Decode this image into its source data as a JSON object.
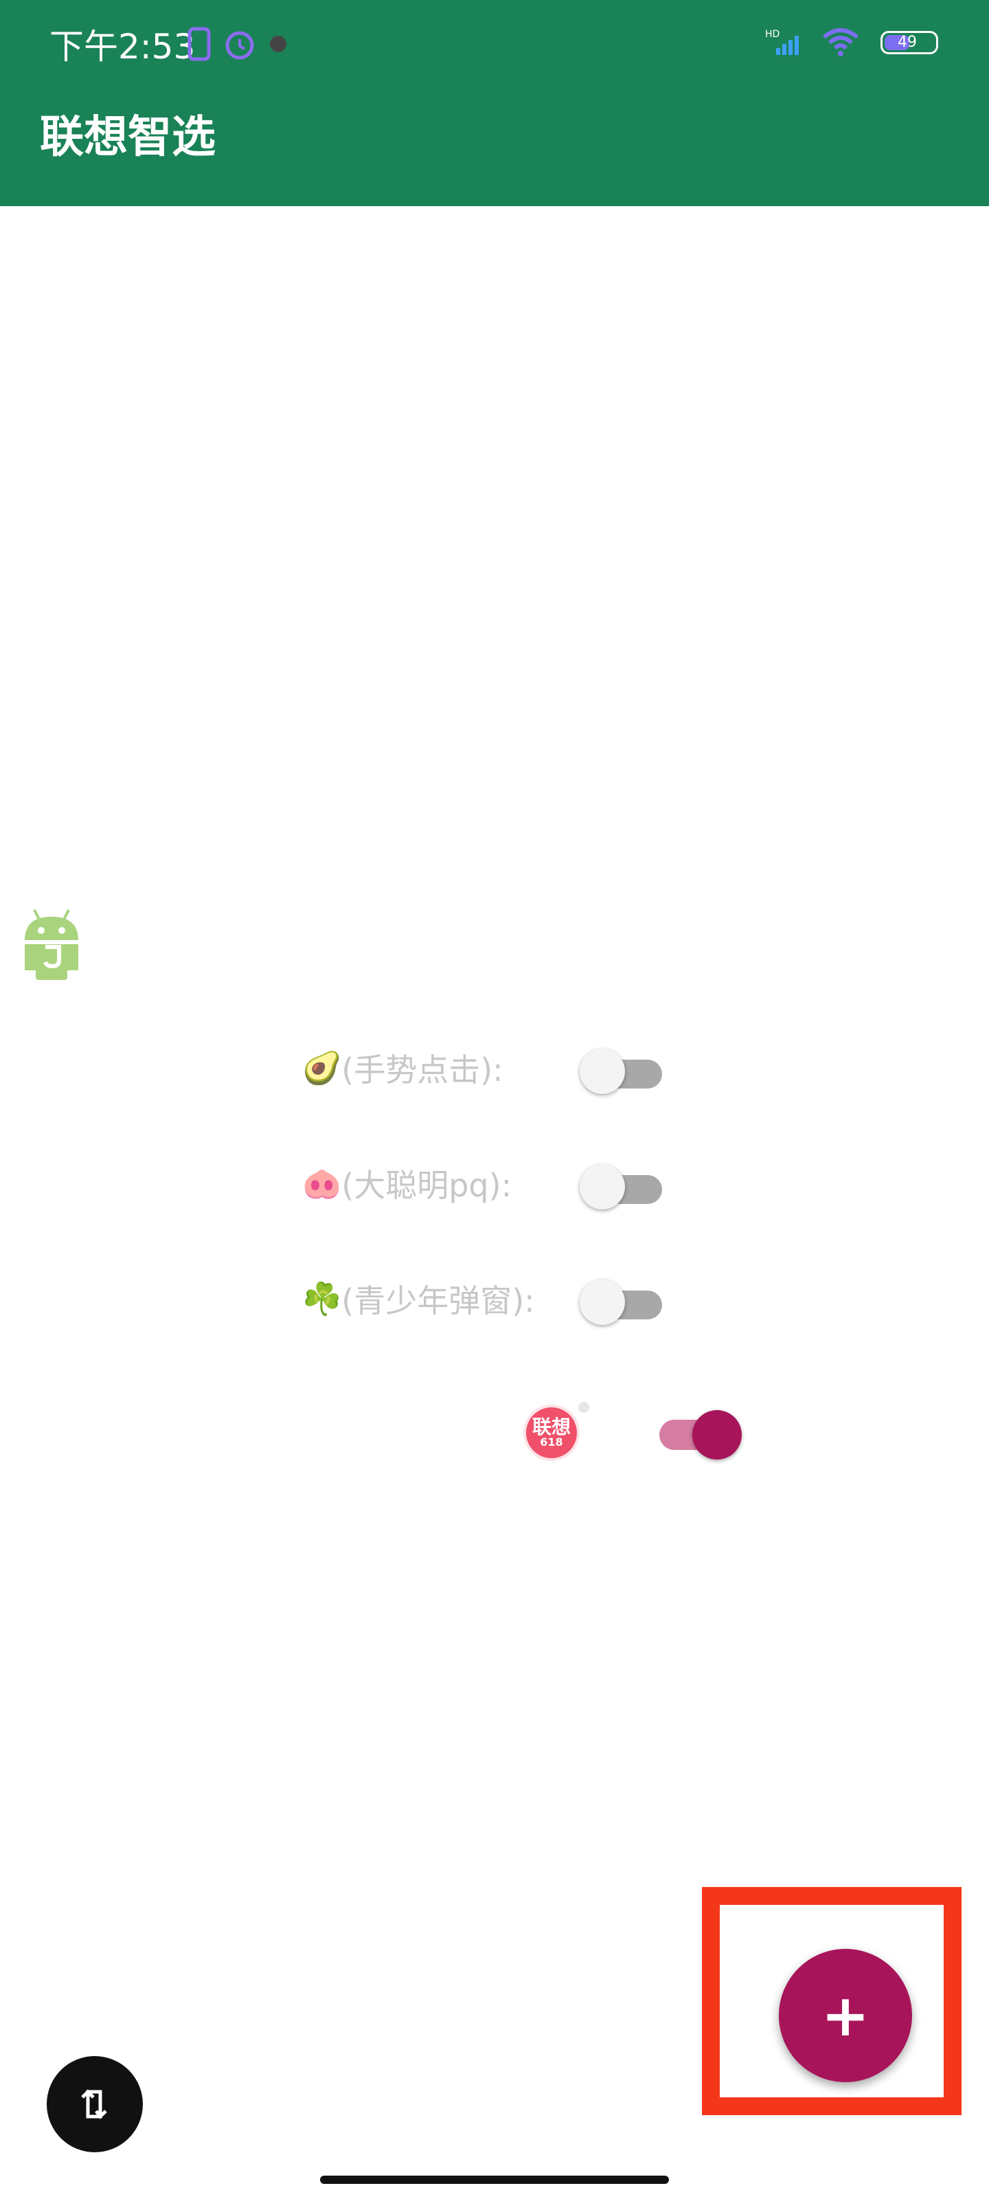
{
  "status_bar": {
    "time": "下午2:53",
    "battery": "49",
    "network": "HD"
  },
  "app_bar": {
    "title": "联想智选"
  },
  "options": [
    {
      "emoji": "🥑",
      "label": "(手势点击):",
      "enabled": false
    },
    {
      "emoji": "🐽",
      "label": "(大聪明pq):",
      "enabled": false
    },
    {
      "emoji": "☘️",
      "label": "(青少年弹窗):",
      "enabled": false
    }
  ],
  "target_app": {
    "badge_text": "联想",
    "badge_sub": "618",
    "enabled": true
  },
  "fab": {
    "label": "+"
  },
  "colors": {
    "primary": "#1a8257",
    "accent": "#a8145a",
    "highlight": "#f4361a"
  }
}
